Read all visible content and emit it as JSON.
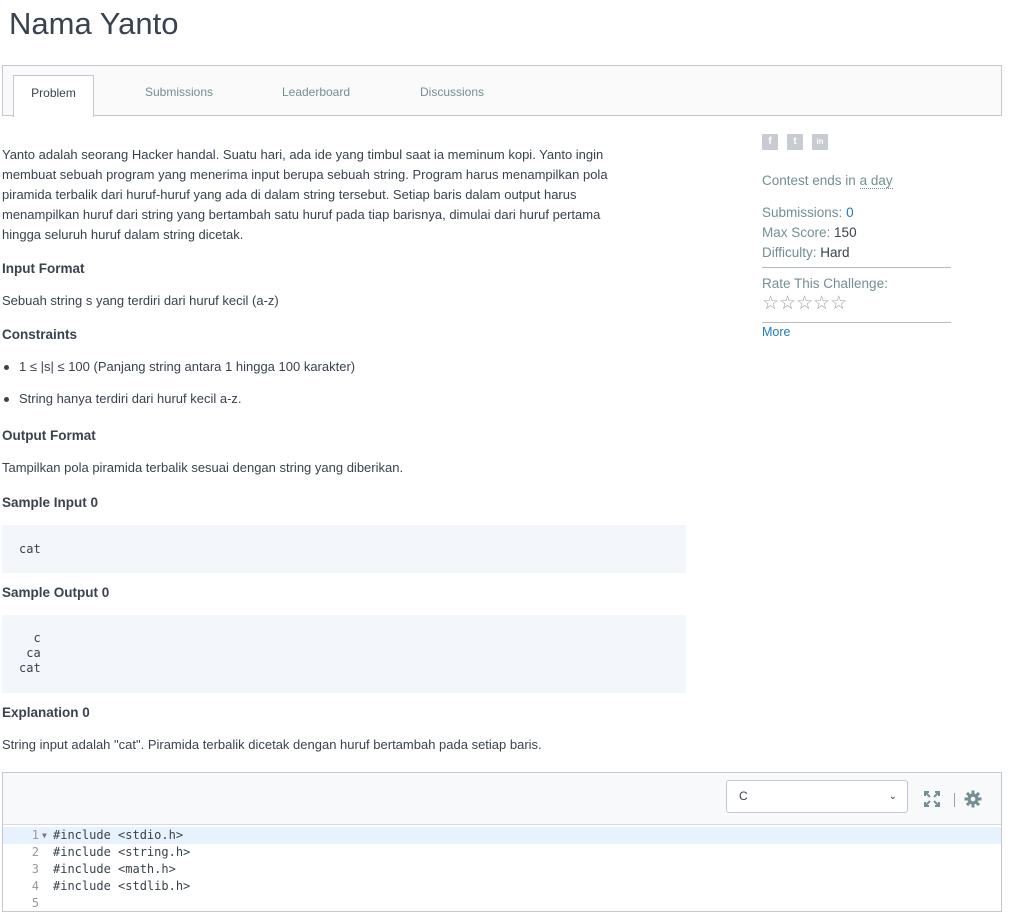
{
  "page": {
    "title": "Nama Yanto"
  },
  "tabs": [
    {
      "label": "Problem",
      "active": true
    },
    {
      "label": "Submissions",
      "active": false
    },
    {
      "label": "Leaderboard",
      "active": false
    },
    {
      "label": "Discussions",
      "active": false
    }
  ],
  "problem": {
    "description_lines": [
      "Yanto adalah seorang Hacker handal. Suatu hari, ada ide yang timbul saat ia meminum kopi. Yanto ingin",
      "membuat sebuah program yang menerima input berupa sebuah string. Program harus menampilkan pola",
      "piramida terbalik dari huruf-huruf yang ada di dalam string tersebut. Setiap baris dalam output harus",
      "menampilkan huruf dari string yang bertambah satu huruf pada tiap barisnya, dimulai dari huruf pertama",
      "hingga seluruh huruf dalam string dicetak."
    ],
    "input_format_heading": "Input Format",
    "input_format_text": "Sebuah string s yang terdiri dari huruf kecil (a-z)",
    "constraints_heading": "Constraints",
    "constraints": [
      "1 ≤ |s| ≤ 100 (Panjang string antara 1 hingga 100 karakter)",
      "String hanya terdiri dari huruf kecil a-z."
    ],
    "output_format_heading": "Output Format",
    "output_format_text": "Tampilkan pola piramida terbalik sesuai dengan string yang diberikan.",
    "sample_input_heading": "Sample Input 0",
    "sample_input": "cat",
    "sample_output_heading": "Sample Output 0",
    "sample_output": "  c\n ca\ncat",
    "explanation_heading": "Explanation 0",
    "explanation_text": "String input adalah \"cat\". Piramida terbalik dicetak dengan huruf bertambah pada setiap baris."
  },
  "sidebar": {
    "social": [
      {
        "icon": "facebook-icon",
        "glyph": "f"
      },
      {
        "icon": "twitter-icon",
        "glyph": "t"
      },
      {
        "icon": "linkedin-icon",
        "glyph": "in"
      }
    ],
    "contest_ends_label": "Contest ends in",
    "contest_ends_value": "a day",
    "submissions_label": "Submissions:",
    "submissions_value": "0",
    "max_score_label": "Max Score:",
    "max_score_value": "150",
    "difficulty_label": "Difficulty:",
    "difficulty_value": "Hard",
    "rate_label": "Rate This Challenge:",
    "rating": 0,
    "stars_max": 5,
    "more_label": "More"
  },
  "editor": {
    "language": "C",
    "lines": [
      {
        "num": "1",
        "code": "#include <stdio.h>"
      },
      {
        "num": "2",
        "code": "#include <string.h>"
      },
      {
        "num": "3",
        "code": "#include <math.h>"
      },
      {
        "num": "4",
        "code": "#include <stdlib.h>"
      },
      {
        "num": "5",
        "code": ""
      }
    ]
  },
  "colors": {
    "accent_green": "#1ba94c",
    "link_blue": "#1b7cc2",
    "text_dark": "#39424e",
    "text_muted": "#738f93"
  }
}
